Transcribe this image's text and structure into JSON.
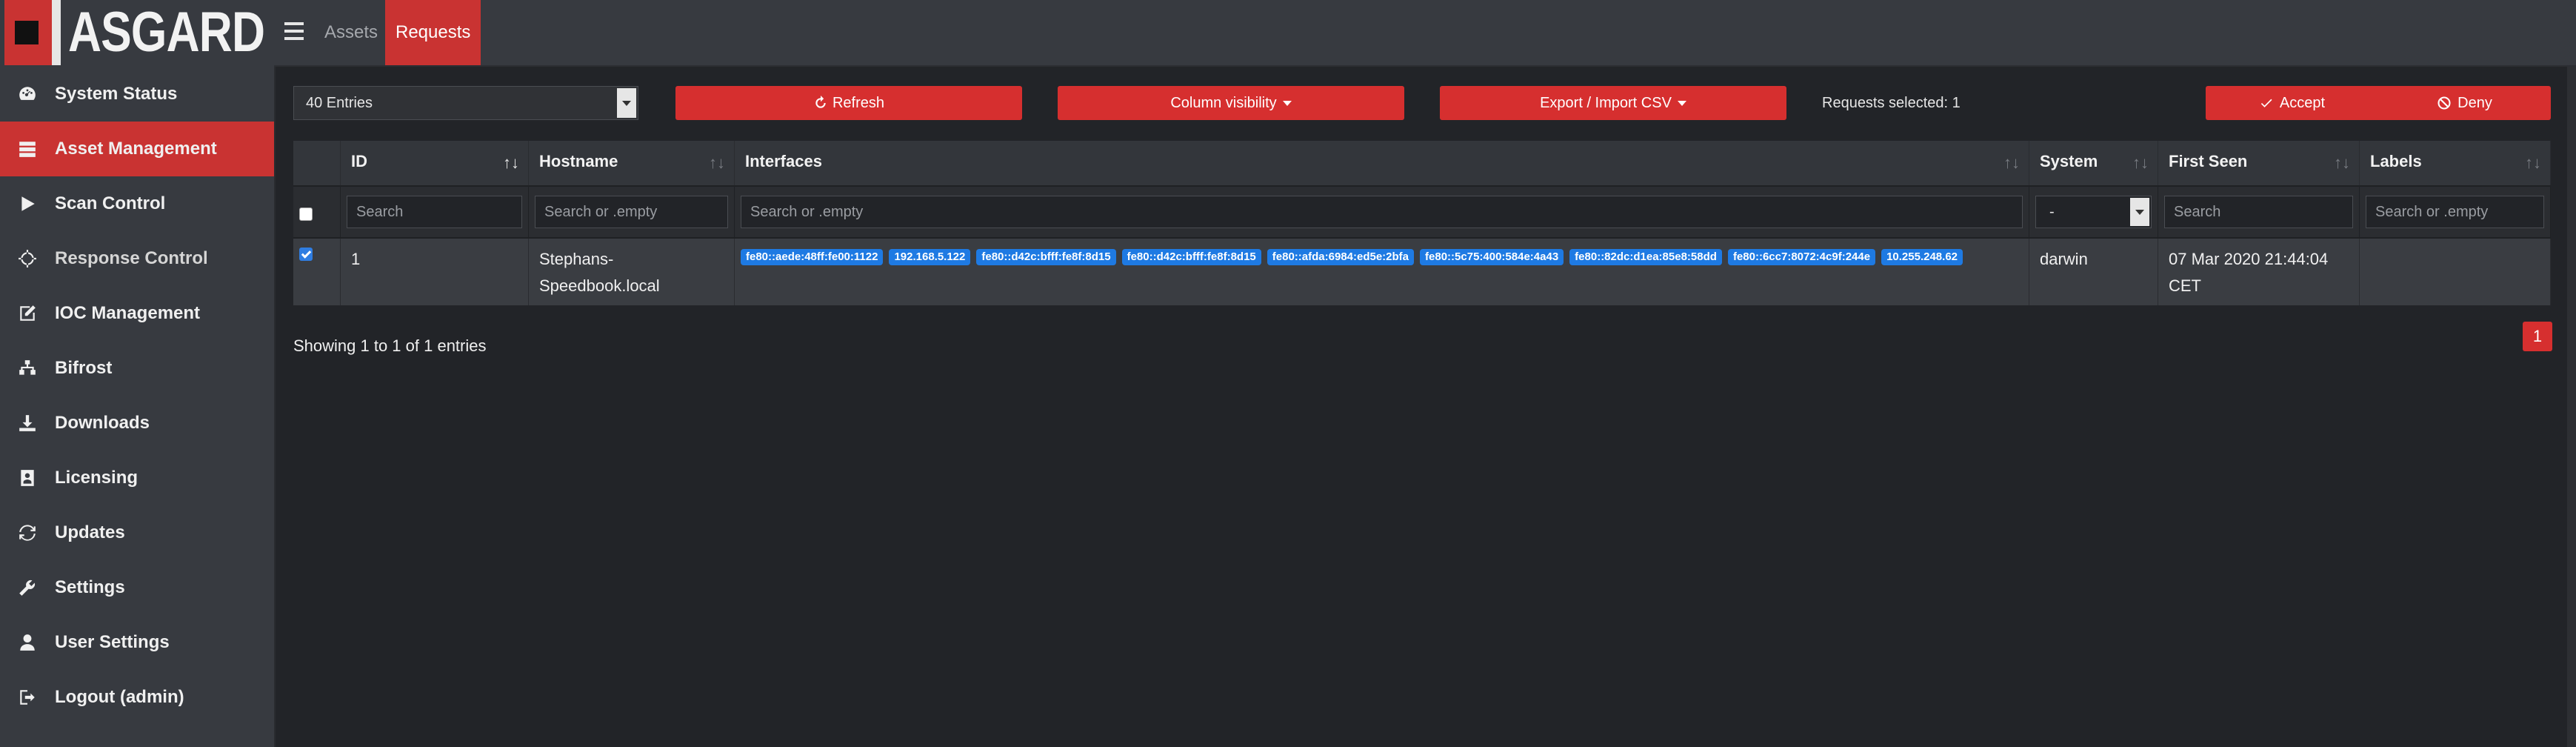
{
  "app": {
    "name": "ASGARD"
  },
  "topbar": {
    "tabs": [
      "Assets",
      "Requests"
    ],
    "active_tab": "Requests"
  },
  "sidebar": {
    "items": [
      {
        "label": "System Status",
        "icon": "dashboard-icon"
      },
      {
        "label": "Asset Management",
        "icon": "server-icon",
        "active": true
      },
      {
        "label": "Scan Control",
        "icon": "play-icon"
      },
      {
        "label": "Response Control",
        "icon": "crosshair-icon"
      },
      {
        "label": "IOC Management",
        "icon": "edit-icon"
      },
      {
        "label": "Bifrost",
        "icon": "sitemap-icon"
      },
      {
        "label": "Downloads",
        "icon": "download-icon"
      },
      {
        "label": "Licensing",
        "icon": "id-card-icon"
      },
      {
        "label": "Updates",
        "icon": "sync-icon"
      },
      {
        "label": "Settings",
        "icon": "wrench-icon"
      },
      {
        "label": "User Settings",
        "icon": "user-icon"
      },
      {
        "label": "Logout (admin)",
        "icon": "sign-out-icon"
      }
    ]
  },
  "toolbar": {
    "entries_value": "40 Entries",
    "refresh_label": "Refresh",
    "column_visibility_label": "Column visibility",
    "export_label": "Export / Import CSV",
    "selected_text": "Requests selected: 1",
    "accept_label": "Accept",
    "deny_label": "Deny"
  },
  "table": {
    "columns": [
      "ID",
      "Hostname",
      "Interfaces",
      "System",
      "First Seen",
      "Labels"
    ],
    "filters": {
      "id": "Search",
      "hostname": "Search or .empty",
      "interfaces": "Search or .empty",
      "system": "-",
      "first_seen": "Search",
      "labels": "Search or .empty"
    },
    "rows": [
      {
        "id": "1",
        "hostname_line1": "Stephans-",
        "hostname_line2": "Speedbook.local",
        "interfaces": [
          "fe80::aede:48ff:fe00:1122",
          "192.168.5.122",
          "fe80::d42c:bfff:fe8f:8d15",
          "fe80::d42c:bfff:fe8f:8d15",
          "fe80::afda:6984:ed5e:2bfa",
          "fe80::5c75:400:584e:4a43",
          "fe80::82dc:d1ea:85e8:58dd",
          "fe80::6cc7:8072:4c9f:244e",
          "10.255.248.62"
        ],
        "system": "darwin",
        "first_seen_line1": "07 Mar 2020 21:44:04",
        "first_seen_line2": "CET",
        "labels": ""
      }
    ]
  },
  "footer": {
    "info": "Showing 1 to 1 of 1 entries",
    "page": "1"
  },
  "colors": {
    "accent": "#d62f2f",
    "tag": "#1e7ae3",
    "sidebar": "#373a40",
    "background": "#222428"
  }
}
